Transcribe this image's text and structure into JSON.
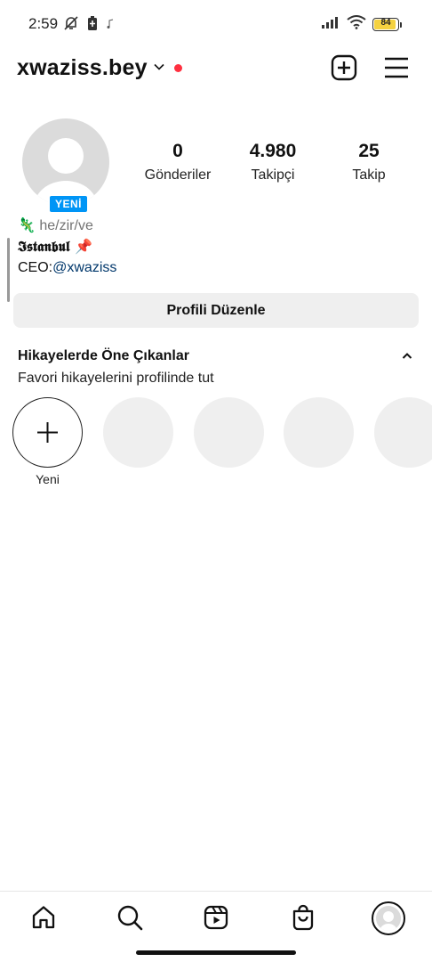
{
  "status_bar": {
    "time": "2:59",
    "battery": "84",
    "battery_level": 0.84
  },
  "header": {
    "username": "xwaziss.bey"
  },
  "profile": {
    "new_badge": "YENİ",
    "stats": [
      {
        "value": "0",
        "label": "Gönderiler"
      },
      {
        "value": "4.980",
        "label": "Takipçi"
      },
      {
        "value": "25",
        "label": "Takip"
      }
    ],
    "bio": {
      "pronouns": "🦎 he/zir/ve",
      "location": "𝕴𝖘𝖙𝖆𝖓𝖇𝖚𝖑 📌",
      "ceo_prefix": "CEO:",
      "ceo_mention": "@xwaziss"
    },
    "edit_button": "Profili Düzenle"
  },
  "highlights": {
    "title": "Hikayelerde Öne Çıkanlar",
    "subtitle": "Favori hikayelerini profilinde tut",
    "new_label": "Yeni"
  },
  "icons": {
    "status": [
      "notifications-off-icon",
      "battery-saver-icon",
      "music-icon",
      "signal-icon",
      "wifi-icon",
      "battery-icon"
    ],
    "header": [
      "chevron-down-icon",
      "add-post-icon",
      "menu-icon"
    ],
    "nav": [
      "home-icon",
      "search-icon",
      "reels-icon",
      "shop-icon",
      "profile-avatar"
    ]
  },
  "colors": {
    "accent": "#0095f6",
    "live_dot": "#ff3040",
    "mention": "#00376b",
    "battery": "#f5d240"
  }
}
